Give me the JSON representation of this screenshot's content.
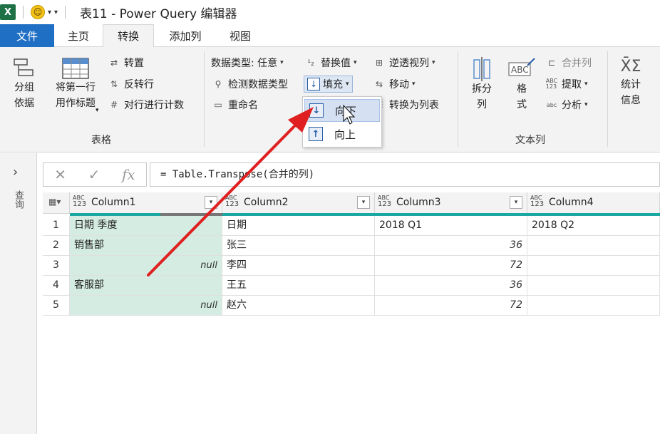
{
  "titlebar": {
    "app_icon": "X",
    "quick_access_arrow": "▾",
    "title": "表11 - Power Query 编辑器"
  },
  "tabs": [
    {
      "label": "文件"
    },
    {
      "label": "主页"
    },
    {
      "label": "转换"
    },
    {
      "label": "添加列"
    },
    {
      "label": "视图"
    }
  ],
  "ribbon": {
    "table_group": {
      "label": "表格",
      "group_by": "分组\n依据",
      "use_first_row": "将第一行\n用作标题",
      "transpose": "转置",
      "reverse_rows": "反转行",
      "count_rows": "对行进行计数"
    },
    "any_column": {
      "data_type": "数据类型: 任意",
      "detect_type": "检测数据类型",
      "rename": "重命名",
      "replace_values": "替换值",
      "fill": "填充",
      "unpivot": "逆透视列",
      "move": "移动",
      "to_list": "转换为列表"
    },
    "text_column": {
      "label": "文本列",
      "split": "拆分\n列",
      "format": "格\n式",
      "merge": "合并列",
      "extract": "提取",
      "parse": "分析"
    },
    "number_column": {
      "statistics": "统计\n信息"
    }
  },
  "fill_menu": {
    "down": "向下",
    "up": "向上"
  },
  "left_pane": {
    "label": "查询"
  },
  "formula": {
    "cancel": "✕",
    "confirm": "✓",
    "fx": "fx",
    "text": "= Table.Transpose(合并的列)"
  },
  "grid": {
    "columns": [
      "Column1",
      "Column2",
      "Column3",
      "Column4"
    ],
    "type_label": "ABC 123",
    "rows": [
      {
        "n": "1",
        "c1": "日期 季度",
        "c2": "日期",
        "c3": "2018 Q1",
        "c4": "2018 Q2"
      },
      {
        "n": "2",
        "c1": "销售部",
        "c2": "张三",
        "c3": "36",
        "c4": ""
      },
      {
        "n": "3",
        "c1": "null",
        "c2": "李四",
        "c3": "72",
        "c4": ""
      },
      {
        "n": "4",
        "c1": "客服部",
        "c2": "王五",
        "c3": "36",
        "c4": ""
      },
      {
        "n": "5",
        "c1": "null",
        "c2": "赵六",
        "c3": "72",
        "c4": ""
      }
    ]
  }
}
